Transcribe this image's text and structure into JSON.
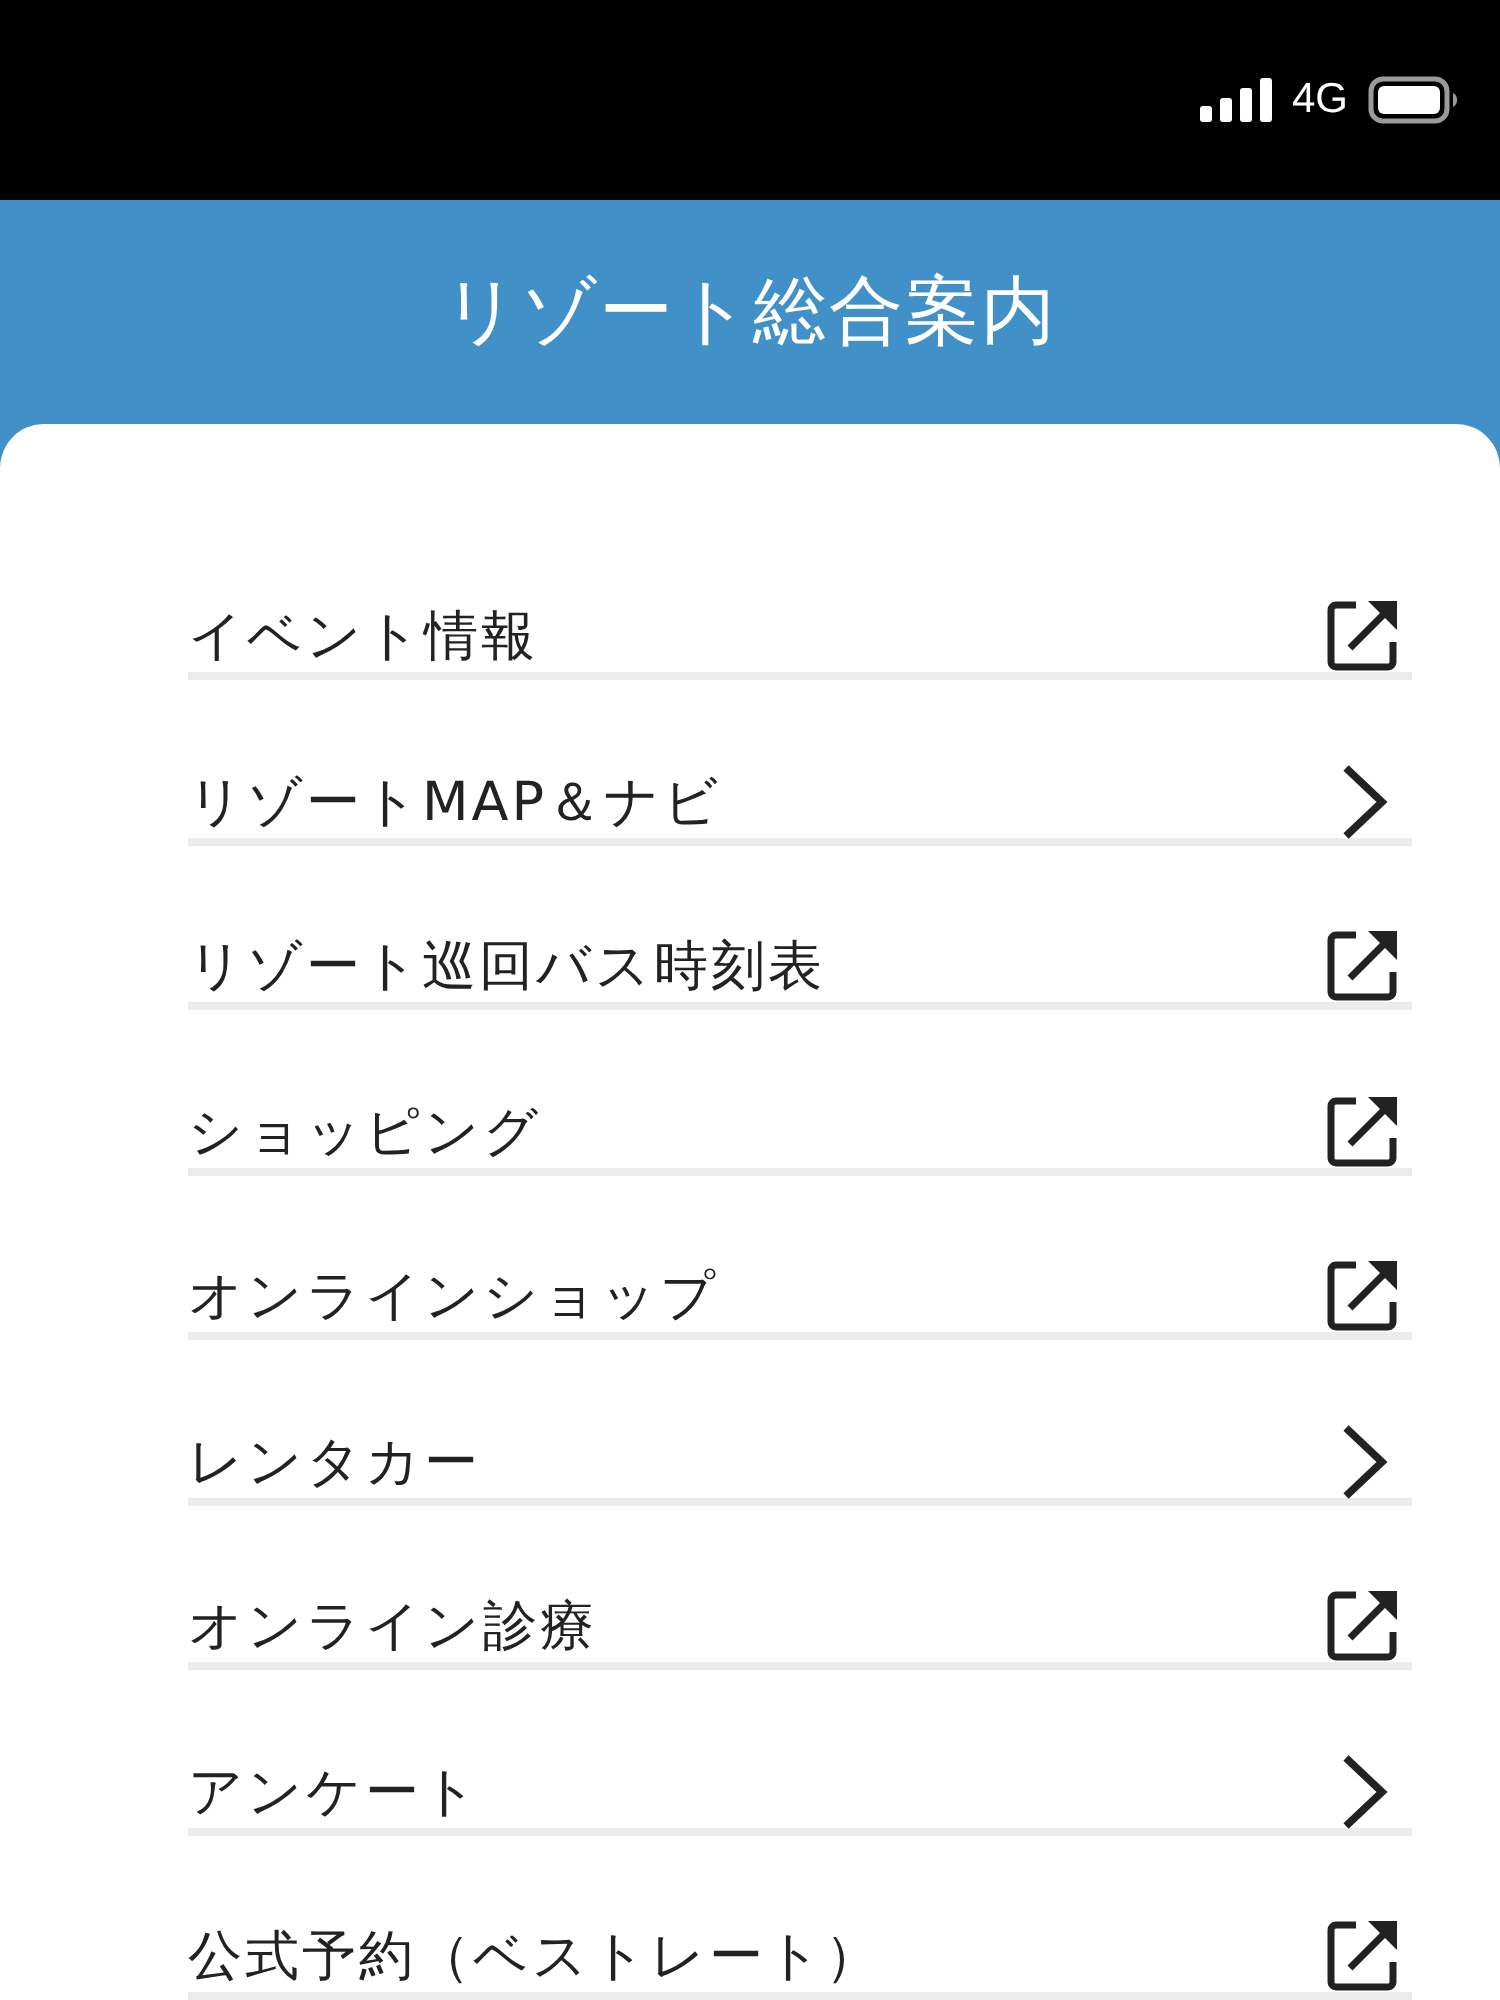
{
  "status_bar": {
    "network": "4G"
  },
  "header": {
    "title": "リゾート総合案内"
  },
  "menu": {
    "items": [
      {
        "label": "イベント情報",
        "kind": "external"
      },
      {
        "label": "リゾートMAP＆ナビ",
        "kind": "internal"
      },
      {
        "label": "リゾート巡回バス時刻表",
        "kind": "external"
      },
      {
        "label": "ショッピング",
        "kind": "external"
      },
      {
        "label": "オンラインショップ",
        "kind": "external"
      },
      {
        "label": "レンタカー",
        "kind": "internal"
      },
      {
        "label": "オンライン診療",
        "kind": "external"
      },
      {
        "label": "アンケート",
        "kind": "internal"
      },
      {
        "label": "公式予約（ベストレート）",
        "kind": "external"
      }
    ]
  }
}
